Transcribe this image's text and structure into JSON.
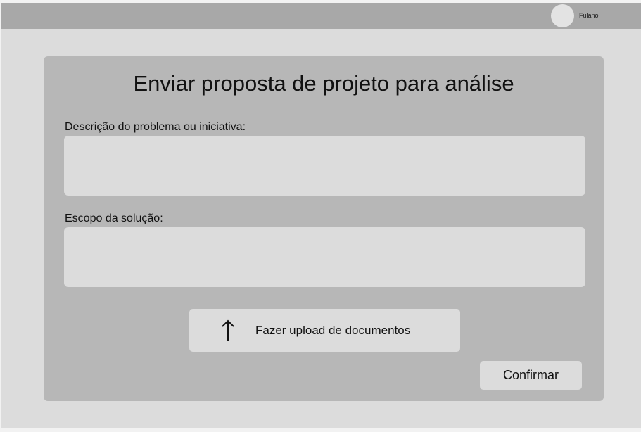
{
  "header": {
    "user_name": "Fulano"
  },
  "form": {
    "title": "Enviar proposta de projeto para análise",
    "description_label": "Descrição do problema ou iniciativa:",
    "description_value": "",
    "scope_label": "Escopo  da solução:",
    "scope_value": "",
    "upload_label": "Fazer upload de documentos",
    "confirm_label": "Confirmar"
  },
  "icons": {
    "upload": "arrow-up-icon",
    "avatar": "avatar"
  },
  "colors": {
    "page_background": "#dcdcdc",
    "header_background": "#a8a8a8",
    "card_background": "#b7b7b7",
    "field_background": "#dcdcdc"
  }
}
